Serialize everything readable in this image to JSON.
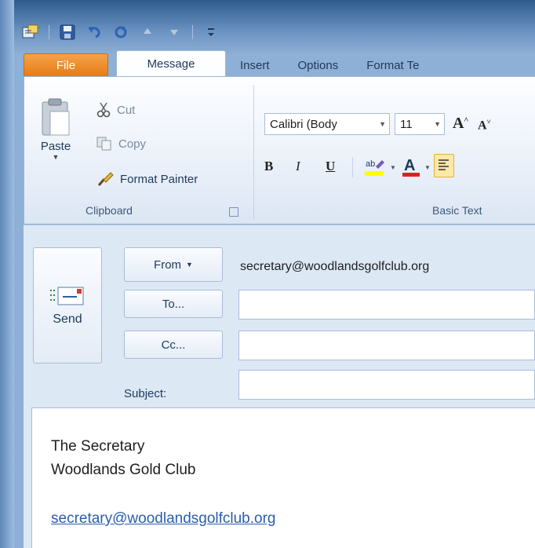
{
  "quick_access": {
    "items": [
      "outlook-icon",
      "save-icon",
      "undo-icon",
      "redo-icon",
      "up-arrow-icon",
      "down-arrow-icon",
      "customize-icon"
    ]
  },
  "tabs": [
    {
      "label": "File"
    },
    {
      "label": "Message"
    },
    {
      "label": "Insert"
    },
    {
      "label": "Options"
    },
    {
      "label": "Format Te"
    }
  ],
  "ribbon": {
    "clipboard": {
      "paste": "Paste",
      "cut": "Cut",
      "copy": "Copy",
      "format_painter": "Format Painter",
      "label": "Clipboard"
    },
    "basic_text": {
      "font_name": "Calibri (Body",
      "font_size": "11",
      "label": "Basic Text",
      "bold": "B",
      "italic": "I",
      "underline": "U"
    }
  },
  "compose": {
    "send_label": "Send",
    "from_label": "From",
    "from_address": "secretary@woodlandsgolfclub.org",
    "to_label": "To...",
    "cc_label": "Cc...",
    "subject_label": "Subject:",
    "body": {
      "line1": "The Secretary",
      "line2": "Woodlands Gold Club",
      "link": "secretary@woodlandsgolfclub.org"
    }
  },
  "colors": {
    "file_tab": "#e67a12",
    "highlight": "#ffff00",
    "font_color": "#e02020",
    "link": "#2a5db0"
  }
}
